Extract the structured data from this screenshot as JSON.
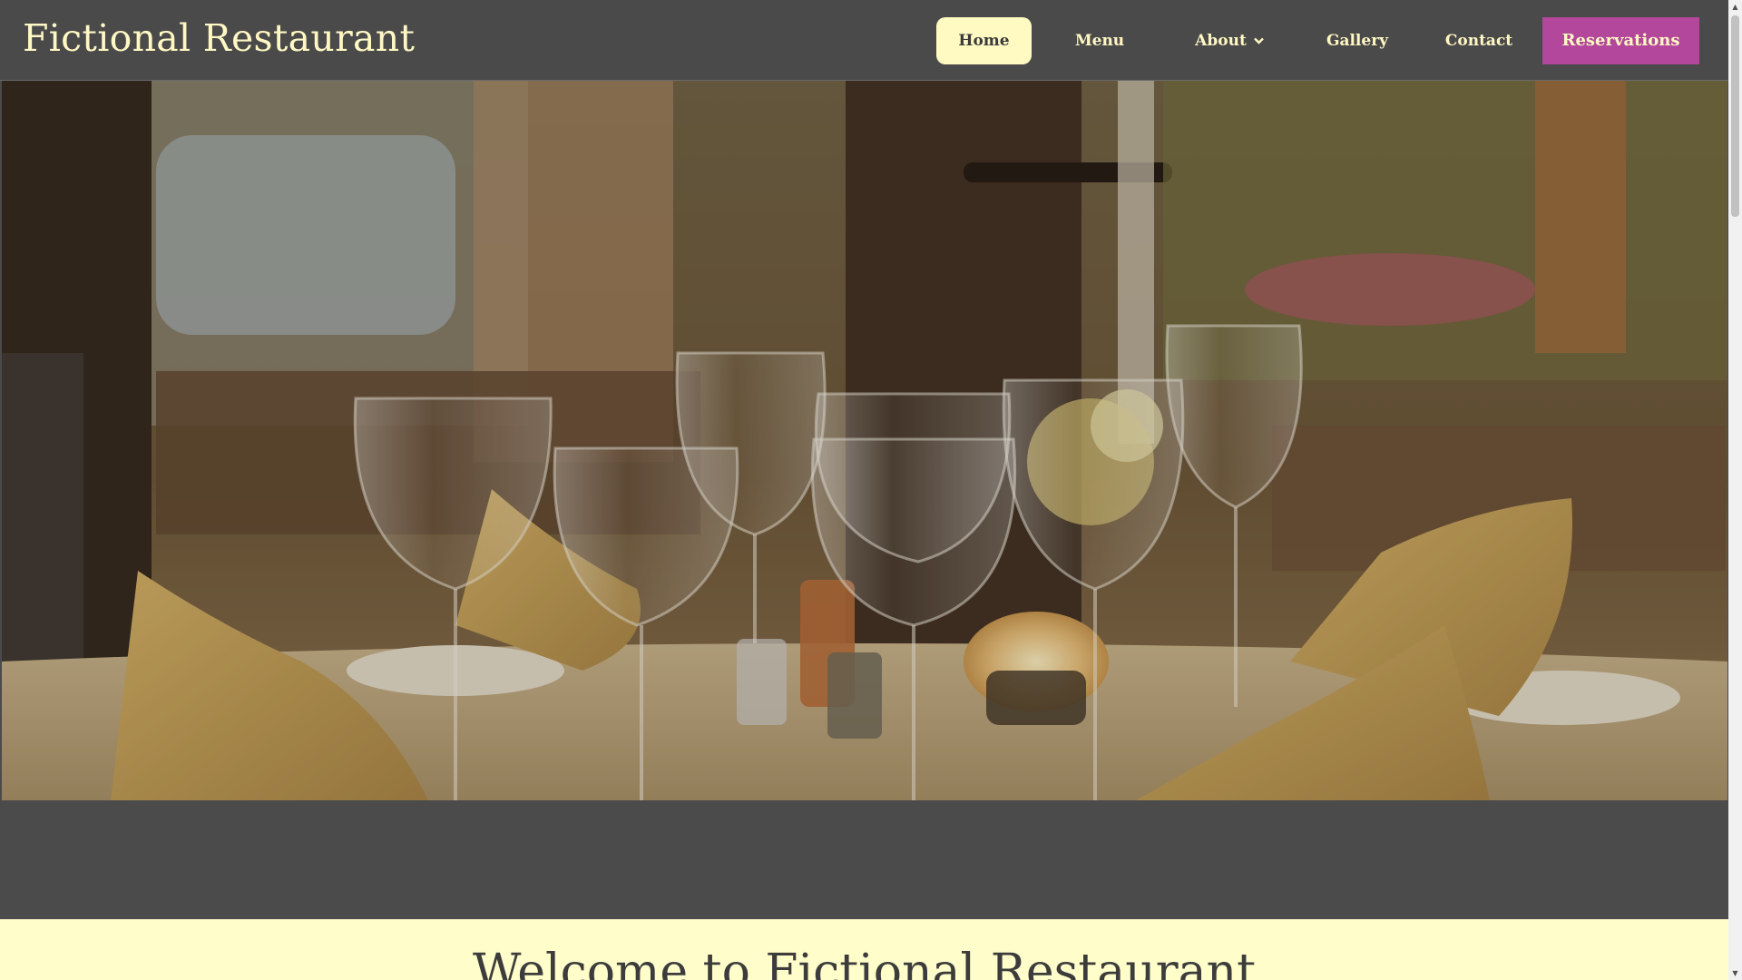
{
  "site": {
    "title": "Fictional Restaurant"
  },
  "nav": {
    "items": [
      {
        "label": "Home",
        "active": true
      },
      {
        "label": "Menu",
        "active": false
      },
      {
        "label": "About",
        "active": false,
        "has_dropdown": true
      },
      {
        "label": "Gallery",
        "active": false
      },
      {
        "label": "Contact",
        "active": false
      }
    ],
    "reservations_label": "Reservations",
    "dropdown_icon": "chevron-down-icon"
  },
  "hero": {
    "image_description_icon": "restaurant-table-photo"
  },
  "welcome": {
    "heading": "Welcome to Fictional Restaurant"
  },
  "colors": {
    "header_bg": "#4a4a4a",
    "text_cream": "#fff8c4",
    "active_bg": "#fffac2",
    "reservations_bg": "#b2479c",
    "welcome_bg": "#fffdc9"
  }
}
